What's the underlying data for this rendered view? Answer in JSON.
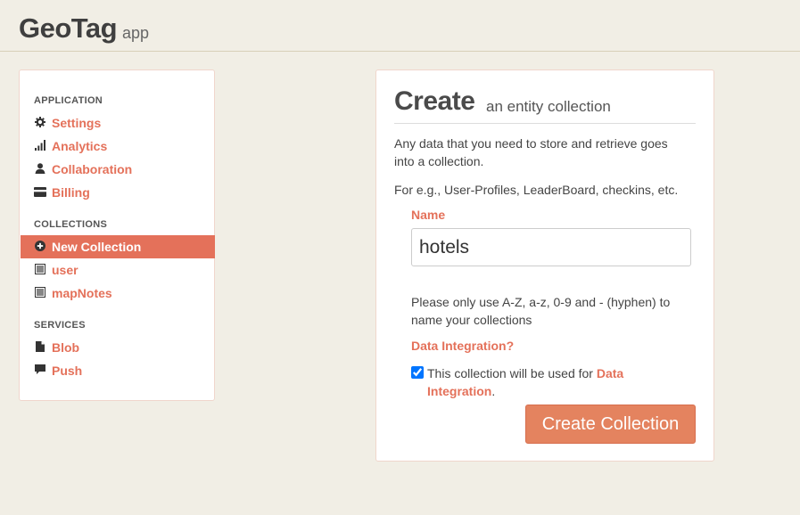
{
  "header": {
    "title": "GeoTag",
    "subtitle": "app"
  },
  "sidebar": {
    "sections": [
      {
        "heading": "APPLICATION"
      },
      {
        "heading": "COLLECTIONS"
      },
      {
        "heading": "SERVICES"
      }
    ],
    "application_items": [
      {
        "label": "Settings",
        "icon": "gear-icon"
      },
      {
        "label": "Analytics",
        "icon": "signal-bars-icon"
      },
      {
        "label": "Collaboration",
        "icon": "user-icon"
      },
      {
        "label": "Billing",
        "icon": "credit-card-icon"
      }
    ],
    "collection_items": [
      {
        "label": "New Collection",
        "icon": "plus-circle-icon",
        "active": true
      },
      {
        "label": "user",
        "icon": "list-icon"
      },
      {
        "label": "mapNotes",
        "icon": "list-icon"
      }
    ],
    "service_items": [
      {
        "label": "Blob",
        "icon": "file-icon"
      },
      {
        "label": "Push",
        "icon": "comment-icon"
      }
    ]
  },
  "panel": {
    "title_main": "Create",
    "title_sub": "an entity collection",
    "description": "Any data that you need to store and retrieve goes into a collection.",
    "example": "For e.g., User-Profiles, LeaderBoard, checkins, etc.",
    "name_label": "Name",
    "name_value": "hotels",
    "hint": "Please only use A-Z, a-z, 0-9 and - (hyphen) to name your collections",
    "integration_label": "Data Integration?",
    "checkbox_text_prefix": "This collection will be used for",
    "checkbox_link": "Data Integration",
    "checkbox_text_suffix": ".",
    "checkbox_checked": true,
    "submit_label": "Create Collection"
  },
  "colors": {
    "accent": "#e4715a",
    "button": "#e4835f",
    "background": "#f1eee5"
  }
}
